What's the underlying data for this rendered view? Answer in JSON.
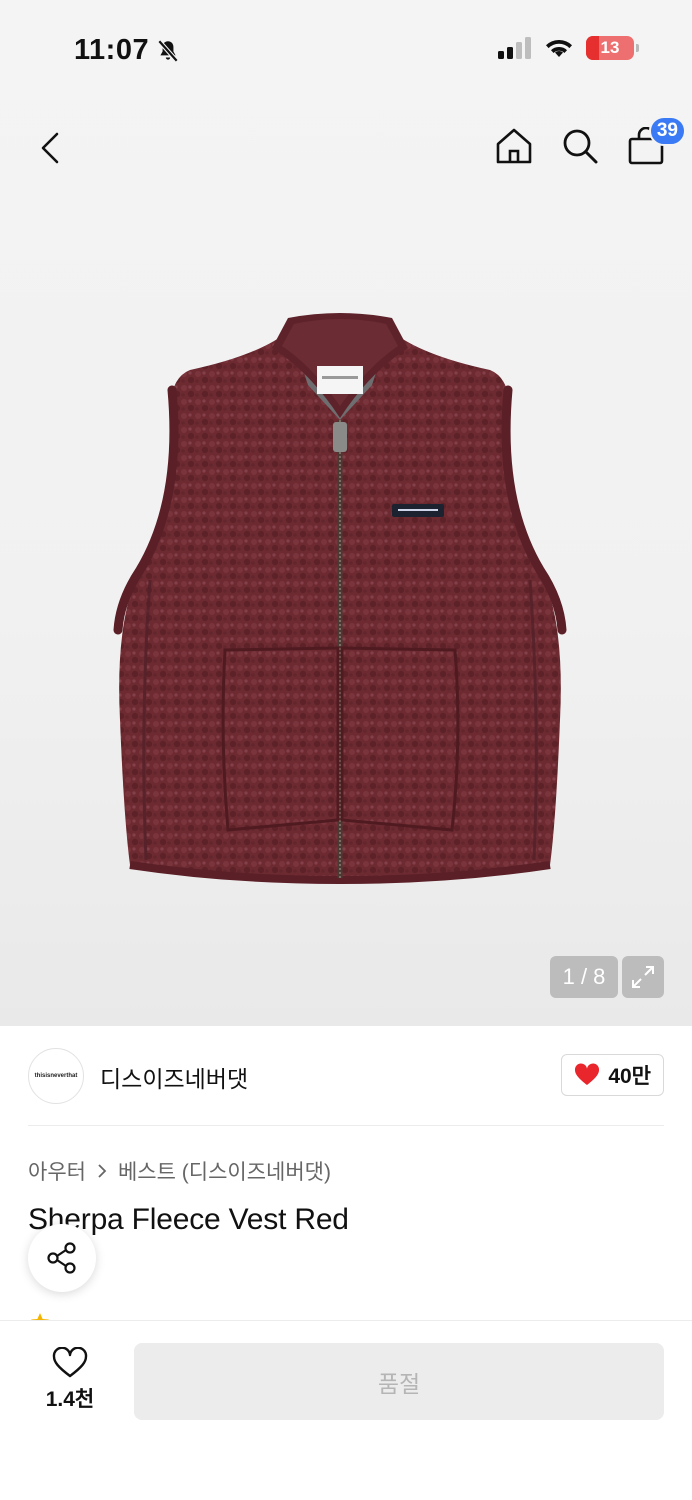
{
  "status_bar": {
    "time": "11:07",
    "battery": "13",
    "icons": [
      "bell-slash-icon",
      "signal-icon",
      "wifi-icon",
      "battery-icon"
    ]
  },
  "nav": {
    "icons": [
      "chevron-left-icon",
      "home-icon",
      "search-icon",
      "bag-icon"
    ],
    "cart_count": "39"
  },
  "gallery": {
    "counter": "1 / 8"
  },
  "brand": {
    "logo_text": "thisisneverthat",
    "name": "디스이즈네버댓",
    "likes": "40만"
  },
  "product": {
    "breadcrumb": [
      "아우터",
      "베스트 (디스이즈네버댓)"
    ],
    "title": "Sherpa Fleece Vest Red"
  },
  "bottom": {
    "wish_count": "1.4천",
    "buy_label": "품절"
  },
  "colors": {
    "accent_blue": "#3a7bf5",
    "heart_red": "#e8262c",
    "vest_burgundy": "#6d2a31"
  }
}
